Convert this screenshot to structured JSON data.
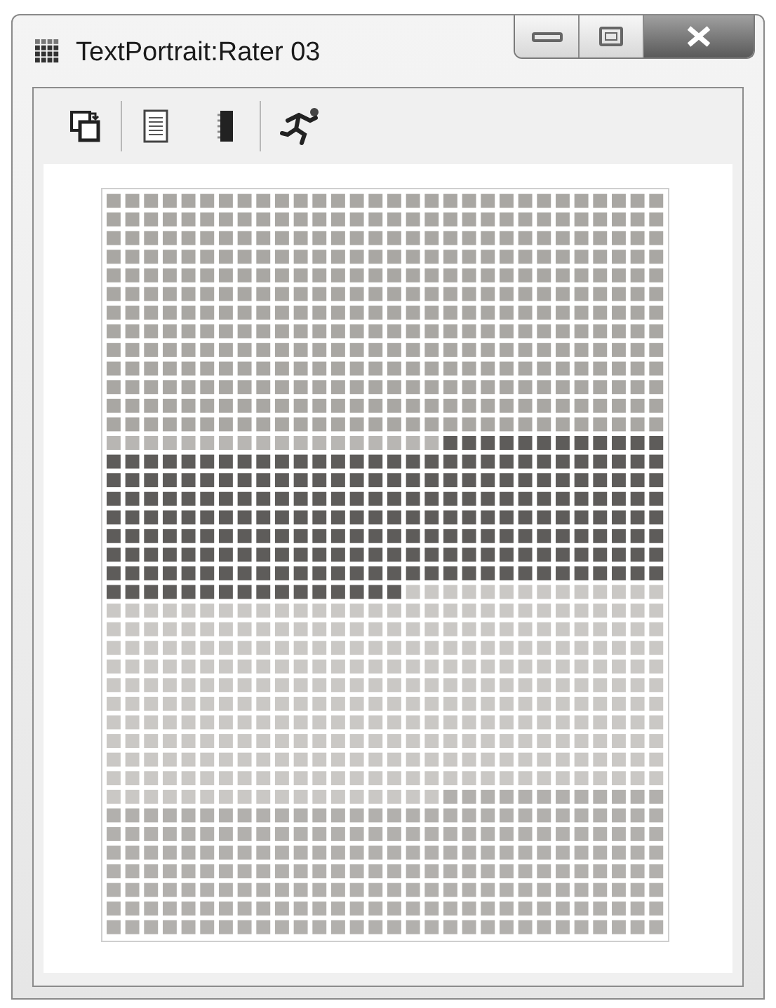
{
  "window": {
    "title": "TextPortrait:Rater 03"
  }
}
